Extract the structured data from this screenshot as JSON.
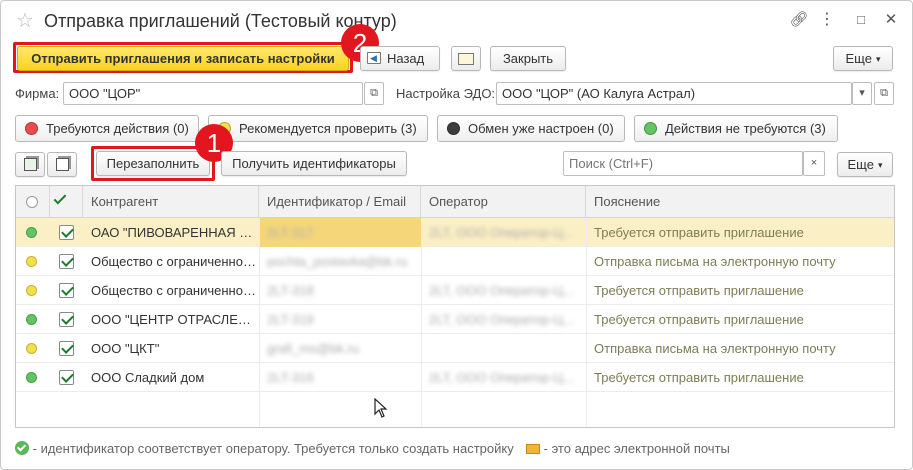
{
  "window": {
    "title": "Отправка приглашений (Тестовый контур)",
    "controls": [
      "link-icon",
      "more-icon",
      "maximize-icon",
      "close-icon"
    ]
  },
  "toolbar": {
    "send_label": "Отправить приглашения и записать настройки",
    "back_label": "Назад",
    "close_label": "Закрыть",
    "more_label": "Еще"
  },
  "annotations": {
    "badge1": "1",
    "badge2": "2"
  },
  "org": {
    "firma_label": "Фирма:",
    "firma_value": "ООО \"ЦОР\"",
    "edo_label": "Настройка ЭДО:",
    "edo_value": "ООО \"ЦОР\" (АО Калуга Астрал)"
  },
  "filters": [
    {
      "label": "Требуются действия (0)",
      "color": "#e84c4c"
    },
    {
      "label": "Рекомендуется проверить (3)",
      "color": "#f2e04a"
    },
    {
      "label": "Обмен уже настроен (0)",
      "color": "#3c3c3c"
    },
    {
      "label": "Действия не требуются (3)",
      "color": "#62c462"
    }
  ],
  "list_toolbar": {
    "refill_label": "Перезаполнить",
    "get_ids_label": "Получить идентификаторы",
    "search_placeholder": "Поиск (Ctrl+F)",
    "more_label": "Еще"
  },
  "table": {
    "columns": [
      "Контрагент",
      "Идентификатор / Email",
      "Оператор",
      "Пояснение"
    ],
    "rows": [
      {
        "status_color": "#62c462",
        "name": "ОАО \"ПИВОВАРЕННАЯ КОМПАНИЯ\"",
        "id": "2LT-317",
        "operator": "2LT, ООО Оператор-Ц...",
        "note": "Требуется отправить приглашение"
      },
      {
        "status_color": "#f2e04a",
        "name": "Общество с ограниченной ответственностью",
        "id": "pochta_postavka@bk.ru",
        "operator": "",
        "note": "Отправка письма на электронную почту"
      },
      {
        "status_color": "#f2e04a",
        "name": "Общество с ограниченной ответственностью",
        "id": "2LT-318",
        "operator": "2LT, ООО Оператор-Ц...",
        "note": "Требуется отправить приглашение"
      },
      {
        "status_color": "#62c462",
        "name": "ООО \"ЦЕНТР ОТРАСЛЕВЫХ РЕШЕНИЙ\"",
        "id": "2LT-319",
        "operator": "2LT, ООО Оператор-Ц...",
        "note": "Требуется отправить приглашение"
      },
      {
        "status_color": "#f2e04a",
        "name": "ООО \"ЦКТ\"",
        "id": "grafi_ms@bk.ru",
        "operator": "",
        "note": "Отправка письма на электронную почту"
      },
      {
        "status_color": "#62c462",
        "name": "ООО Сладкий дом",
        "id": "2LT-316",
        "operator": "2LT, ООО Оператор-Ц...",
        "note": "Требуется отправить приглашение"
      }
    ]
  },
  "footer": {
    "ok_note": "- идентификатор соответствует оператору. Требуется только создать настройку",
    "mail_note": "- это адрес электронной почты"
  }
}
